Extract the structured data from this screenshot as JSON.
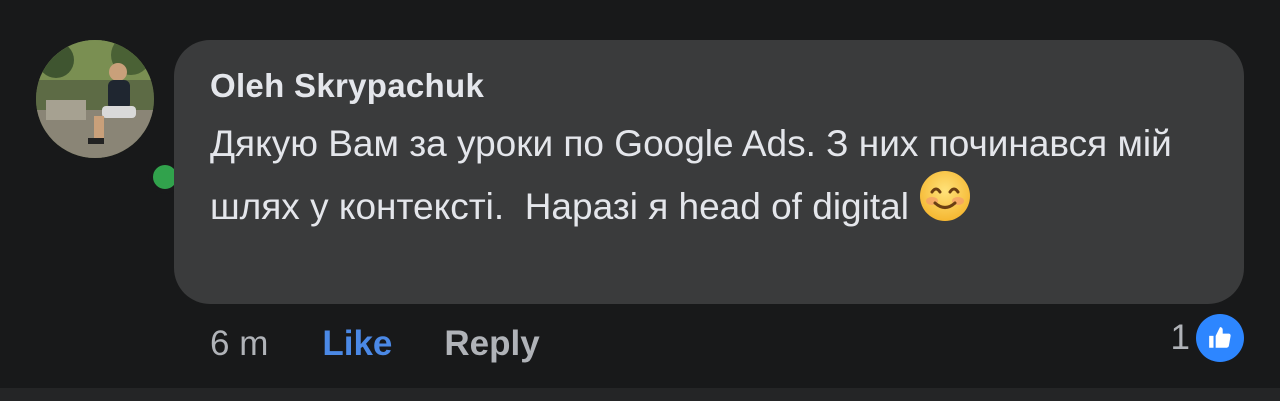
{
  "comment": {
    "author": "Oleh Skrypachuk",
    "text": "Дякую Вам за уроки по Google Ads. З них починався мій шлях у контексті.  Наразі я head of digital",
    "emoji": "smiling-face-icon",
    "online": true
  },
  "actions": {
    "time": "6 m",
    "like_label": "Like",
    "reply_label": "Reply"
  },
  "reactions": {
    "count": "1",
    "type": "like-reaction-icon"
  },
  "colors": {
    "background": "#18191a",
    "bubble": "#3a3b3c",
    "text": "#e4e6eb",
    "secondary_text": "#b0b3b8",
    "like_blue": "#4b89e6",
    "online_green": "#31a24c",
    "reaction_blue": "#2d86ff"
  }
}
